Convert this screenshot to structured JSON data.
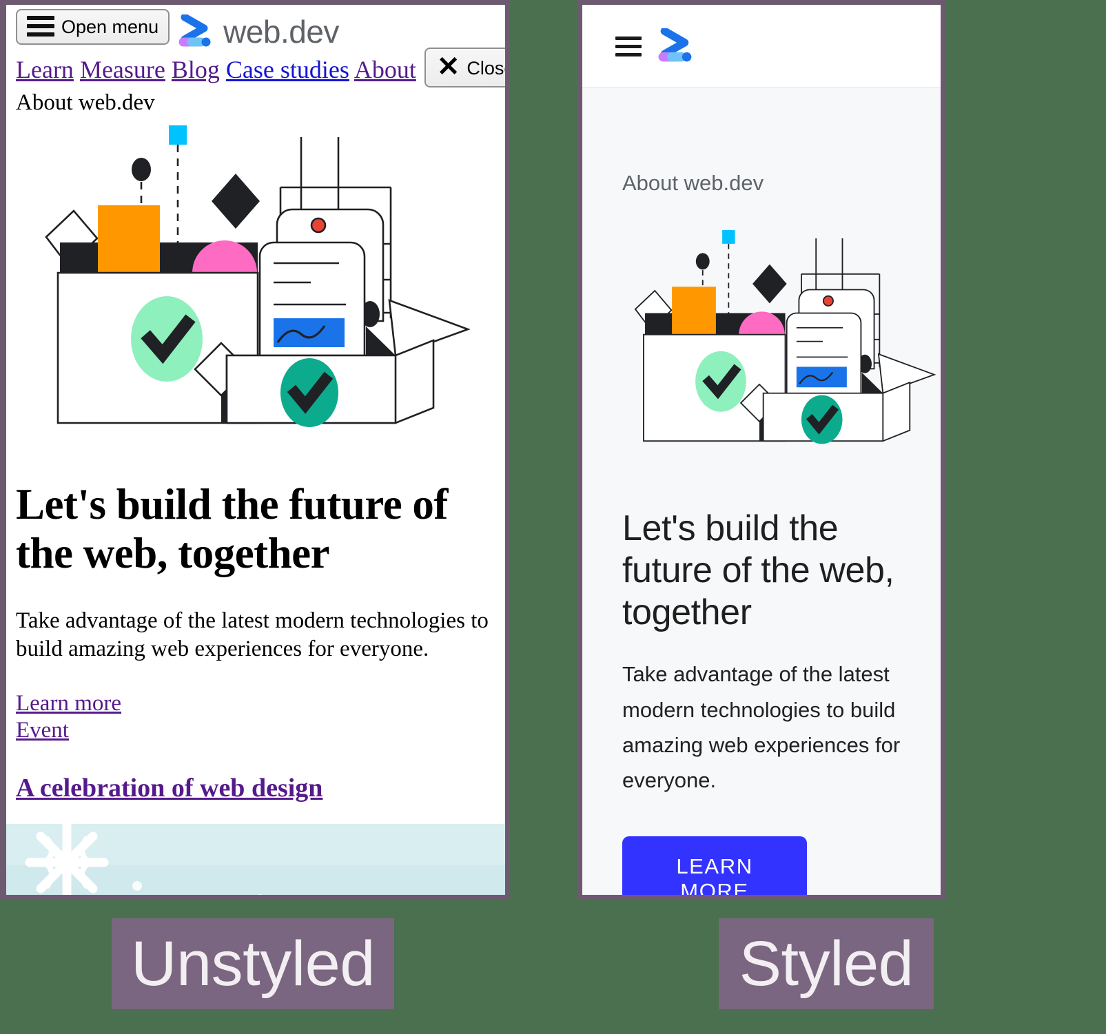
{
  "page": {
    "background_color": "#4a704f",
    "panel_border_color": "#6e5a70"
  },
  "captions": {
    "left": "Unstyled",
    "right": "Styled",
    "box_color": "#7a6680",
    "text_color": "#f2eef2"
  },
  "unstyled_panel": {
    "open_menu_button": "Open menu",
    "close_button": "Close",
    "logo_wordmark": "web.dev",
    "nav_items": [
      {
        "label": "Learn",
        "state": "visited"
      },
      {
        "label": "Measure",
        "state": "visited"
      },
      {
        "label": "Blog",
        "state": "visited"
      },
      {
        "label": "Case studies",
        "state": "link"
      },
      {
        "label": "About",
        "state": "visited"
      }
    ],
    "breadcrumb": "About web.dev",
    "heading": "Let's build the future of the web, together",
    "paragraph": "Take advantage of the latest modern technologies to build amazing web experiences for everyone.",
    "links": [
      "Learn more",
      "Event"
    ],
    "card_title": "A celebration of web design",
    "link_color_visited": "#551a8b",
    "link_color_unvisited": "#1414d6"
  },
  "styled_panel": {
    "breadcrumb": "About web.dev",
    "heading": "Let's build the future of the web, together",
    "paragraph": "Take advantage of the latest modern technologies to build amazing web experiences for everyone.",
    "cta_label": "LEARN MORE",
    "cta_color": "#3333ff",
    "header_background": "#ffffff",
    "body_background": "#f6f8f9",
    "breadcrumb_color": "#5f6368"
  },
  "illustration": {
    "name": "open-box-with-shapes-and-document",
    "colors": {
      "orange": "#ff9800",
      "cyan": "#00c2ff",
      "pink": "#fd6bc3",
      "blue": "#1a73e8",
      "mint": "#8ef0bd",
      "teal": "#0cab8d",
      "dark": "#202124",
      "red": "#ea4335"
    }
  },
  "card_image": {
    "name": "winter-snowflake-banner",
    "colors": {
      "sky": "#cfe9ec",
      "snow": "#ffffff",
      "script_red": "#cf3a1d"
    }
  }
}
